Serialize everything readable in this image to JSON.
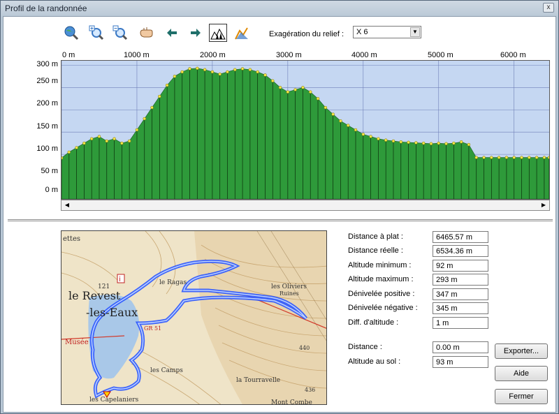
{
  "window": {
    "title": "Profil de la randonnée",
    "close_label": "x"
  },
  "toolbar": {
    "buttons": [
      {
        "name": "globe-search-icon"
      },
      {
        "name": "zoom-in-icon"
      },
      {
        "name": "zoom-out-icon"
      },
      {
        "name": "pan-hand-icon"
      },
      {
        "name": "arrow-left-icon"
      },
      {
        "name": "arrow-right-icon"
      },
      {
        "name": "profile-trees-icon"
      },
      {
        "name": "profile-measure-icon"
      }
    ],
    "relief_label": "Exagération du relief :",
    "relief_value": "X 6"
  },
  "colors": {
    "sky": "#c5d7f2",
    "terrain": "#2e9a3a",
    "stem": "#0a2e0a",
    "marker": "#f5e94a",
    "track": "#2b56ff"
  },
  "chart_data": {
    "type": "area",
    "x_tick_labels": [
      "0 m",
      "1000 m",
      "2000 m",
      "3000 m",
      "4000 m",
      "5000 m",
      "6000 m"
    ],
    "y_tick_labels": [
      "300 m",
      "250 m",
      "200 m",
      "150 m",
      "100 m",
      "50 m",
      "0 m"
    ],
    "x_ticks": [
      0,
      1000,
      2000,
      3000,
      4000,
      5000,
      6000
    ],
    "y_ticks": [
      300,
      250,
      200,
      150,
      100,
      50,
      0
    ],
    "xlim": [
      0,
      6466
    ],
    "ylim": [
      0,
      310
    ],
    "grid": true,
    "x": [
      0,
      100,
      200,
      300,
      400,
      500,
      600,
      700,
      800,
      900,
      1000,
      1100,
      1200,
      1300,
      1400,
      1500,
      1600,
      1700,
      1800,
      1900,
      2000,
      2100,
      2200,
      2300,
      2400,
      2500,
      2600,
      2700,
      2800,
      2900,
      3000,
      3100,
      3200,
      3300,
      3400,
      3500,
      3600,
      3700,
      3800,
      3900,
      4000,
      4100,
      4200,
      4300,
      4400,
      4500,
      4600,
      4700,
      4800,
      4900,
      5000,
      5100,
      5200,
      5300,
      5400,
      5500,
      5600,
      5700,
      5800,
      5900,
      6000,
      6100,
      6200,
      6300,
      6400,
      6466
    ],
    "y": [
      92,
      105,
      115,
      125,
      135,
      140,
      130,
      135,
      125,
      130,
      155,
      180,
      205,
      230,
      255,
      275,
      285,
      292,
      293,
      290,
      285,
      280,
      285,
      290,
      292,
      290,
      285,
      278,
      265,
      250,
      240,
      245,
      250,
      240,
      225,
      205,
      190,
      175,
      165,
      155,
      145,
      140,
      135,
      132,
      130,
      128,
      127,
      126,
      125,
      124,
      125,
      124,
      125,
      128,
      122,
      93,
      93,
      93,
      93,
      93,
      93,
      93,
      93,
      93,
      93,
      93
    ]
  },
  "stats": [
    {
      "label": "Distance à plat :",
      "value": "6465.57 m"
    },
    {
      "label": "Distance réelle :",
      "value": "6534.36 m"
    },
    {
      "label": "Altitude minimum :",
      "value": "92 m"
    },
    {
      "label": "Altitude maximum :",
      "value": "293 m"
    },
    {
      "label": "Dénivelée positive :",
      "value": "347 m"
    },
    {
      "label": "Dénivelée négative :",
      "value": "345 m"
    },
    {
      "label": "Diff. d'altitude :",
      "value": "1 m"
    }
  ],
  "cursor": {
    "distance_label": "Distance :",
    "distance_value": "0.00 m",
    "ground_label": "Altitude au sol :",
    "ground_value": "93 m"
  },
  "buttons": {
    "export": "Exporter...",
    "help": "Aide",
    "close": "Fermer"
  },
  "map": {
    "labels": [
      "ettes",
      "le Revest",
      "-les-Eaux",
      "Musée",
      "le Ragas",
      "les Oliviers",
      "Ruines",
      "les Camps",
      "la Tourravelle",
      "les Capelaniers",
      "Mont Combe",
      "121",
      "440",
      "436",
      "GR 51"
    ]
  }
}
